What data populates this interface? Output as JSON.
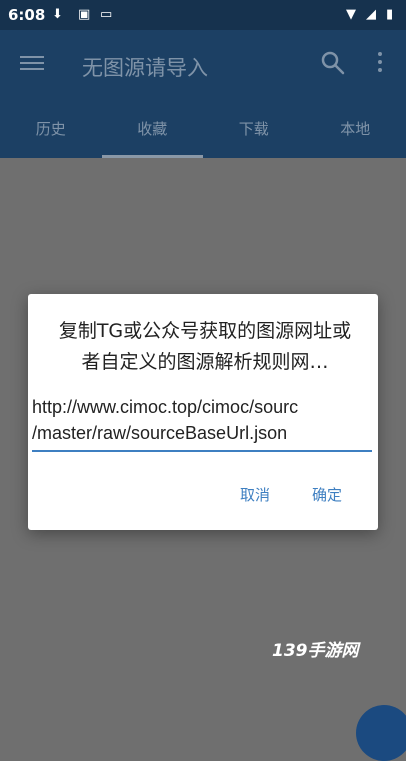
{
  "status_bar": {
    "time": "6:08",
    "icons": [
      "download-icon",
      "notification-icon",
      "keyboard-icon",
      "wifi-icon",
      "signal-icon",
      "battery-icon"
    ]
  },
  "app_bar": {
    "title": "无图源请导入",
    "icons": [
      "menu-icon",
      "search-icon",
      "more-icon"
    ]
  },
  "tabs": [
    {
      "label": "历史",
      "active": false
    },
    {
      "label": "收藏",
      "active": true
    },
    {
      "label": "下载",
      "active": false
    },
    {
      "label": "本地",
      "active": false
    }
  ],
  "dialog": {
    "message": "复制TG或公众号获取的图源网址或者自定义的图源解析规则网…",
    "input_value": "http://www.cimoc.top/cimoc/sourc\n/master/raw/sourceBaseUrl.json",
    "cancel_label": "取消",
    "ok_label": "确定"
  },
  "watermark": "139手游网",
  "colors": {
    "status_bar": "#16324e",
    "app_bar": "#1c4064",
    "accent": "#3e7fc1",
    "scrim": "#6f6f6f"
  }
}
